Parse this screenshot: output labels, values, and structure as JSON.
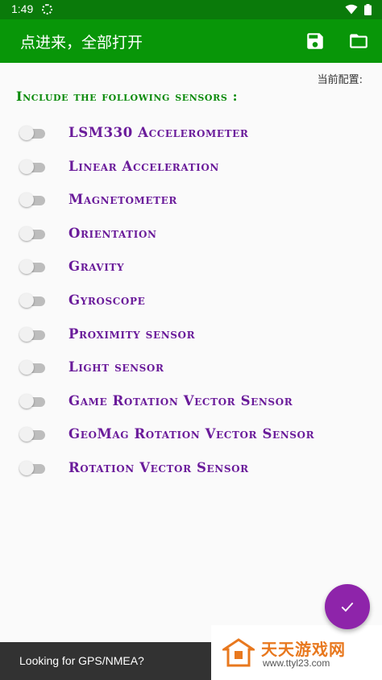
{
  "statusbar": {
    "time": "1:49"
  },
  "appbar": {
    "title": "点进来，全部打开",
    "save_icon": "save-icon",
    "folder_icon": "folder-icon"
  },
  "config_label": "当前配置:",
  "heading": "Include the following sensors :",
  "sensors": [
    {
      "label": "LSM330 Accelerometer",
      "enabled": false
    },
    {
      "label": "Linear Acceleration",
      "enabled": false
    },
    {
      "label": "Magnetometer",
      "enabled": false
    },
    {
      "label": "Orientation",
      "enabled": false
    },
    {
      "label": "Gravity",
      "enabled": false
    },
    {
      "label": "Gyroscope",
      "enabled": false
    },
    {
      "label": "Proximity sensor",
      "enabled": false
    },
    {
      "label": "Light sensor",
      "enabled": false
    },
    {
      "label": "Game Rotation Vector Sensor",
      "enabled": false
    },
    {
      "label": "GeoMag Rotation Vector Sensor",
      "enabled": false
    },
    {
      "label": "Rotation Vector Sensor",
      "enabled": false
    }
  ],
  "fab_icon": "check-icon",
  "snackbar": {
    "message": "Looking for GPS/NMEA?"
  },
  "watermark": {
    "brand": "天天游戏网",
    "url": "www.ttyl23.com"
  },
  "colors": {
    "appbar": "#089608",
    "statusbar": "#0a7a0a",
    "heading": "#0a8a0a",
    "sensor_label": "#6a1b9a",
    "fab": "#8e24aa",
    "snackbar": "#323232",
    "watermark": "#e8781e"
  }
}
